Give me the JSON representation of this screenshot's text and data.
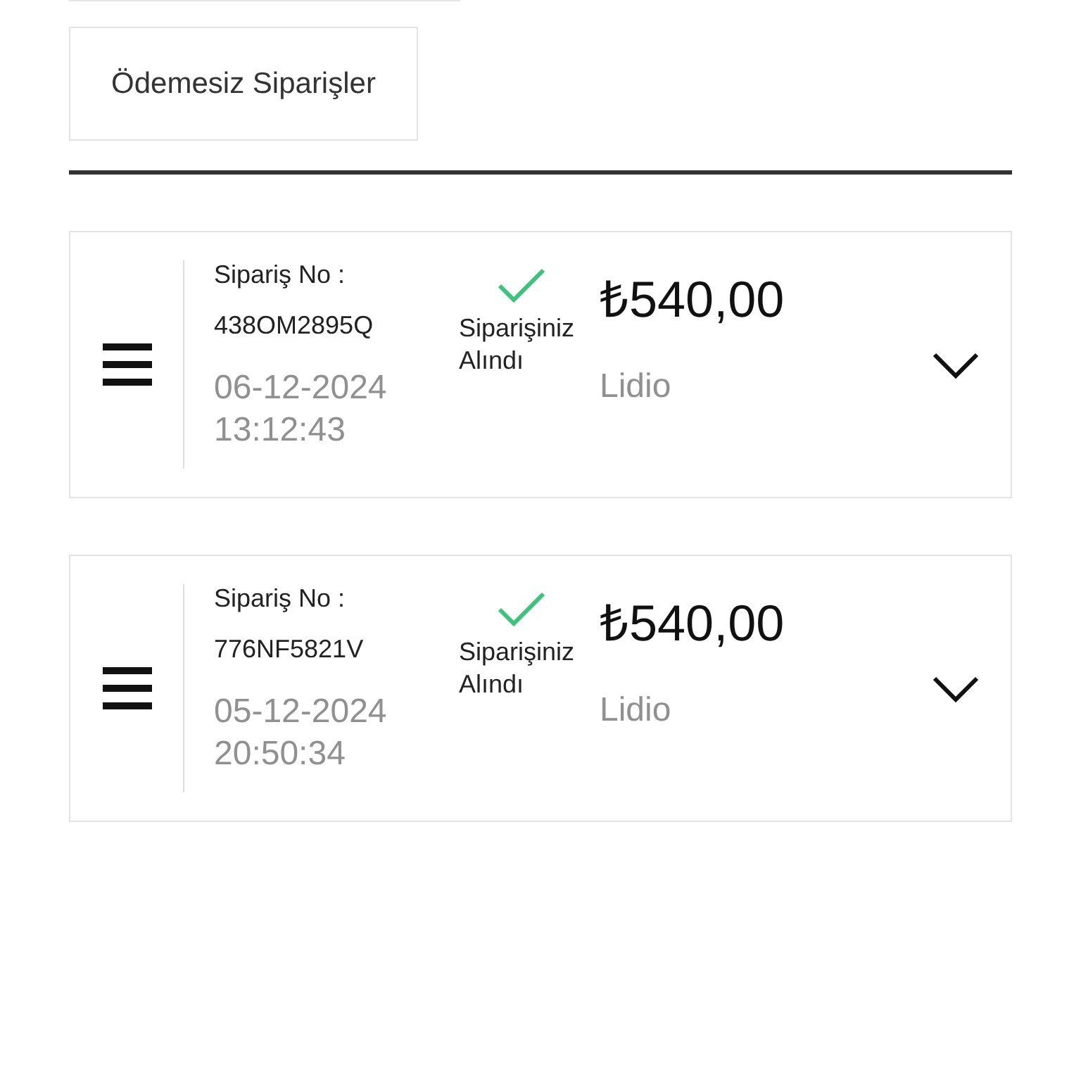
{
  "filter_button": {
    "label": "Ödemesiz Siparişler"
  },
  "orders": [
    {
      "order_no_label": "Sipariş No :",
      "order_no": "438OM2895Q",
      "date": "06-12-2024",
      "time": "13:12:43",
      "status": {
        "kind": "received",
        "text": "Siparişiniz Alındı"
      },
      "amount": "₺540,00",
      "provider": "Lidio",
      "expanded": false
    },
    {
      "order_no_label": "Sipariş No :",
      "order_no": "776NF5821V",
      "date": "05-12-2024",
      "time": "20:50:34",
      "status": {
        "kind": "received",
        "text": "Siparişiniz Alındı"
      },
      "amount": "₺540,00",
      "provider": "Lidio",
      "expanded": false
    }
  ]
}
